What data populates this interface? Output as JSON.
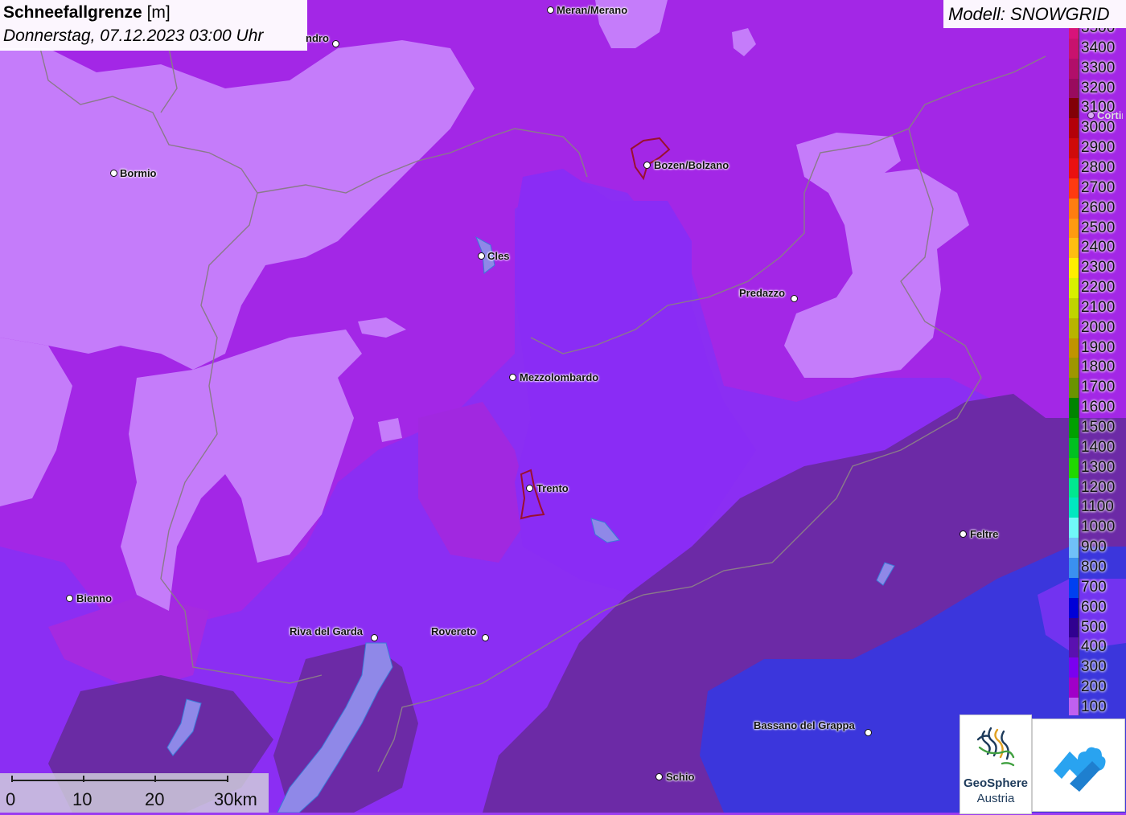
{
  "header": {
    "title_bold": "Schneefallgrenze",
    "title_unit": "[m]",
    "datetime": "Donnerstag, 07.12.2023 03:00 Uhr"
  },
  "model_label": "Modell: SNOWGRID",
  "legend": {
    "items": [
      {
        "label": "3500",
        "color": "#d8137a"
      },
      {
        "label": "3400",
        "color": "#c8126e"
      },
      {
        "label": "3300",
        "color": "#b10e6a"
      },
      {
        "label": "3200",
        "color": "#990a5e"
      },
      {
        "label": "3100",
        "color": "#820006"
      },
      {
        "label": "3000",
        "color": "#b4000a"
      },
      {
        "label": "2900",
        "color": "#d00a0a"
      },
      {
        "label": "2800",
        "color": "#ea1010"
      },
      {
        "label": "2700",
        "color": "#ff3a10"
      },
      {
        "label": "2600",
        "color": "#ff7d10"
      },
      {
        "label": "2500",
        "color": "#ff9a10"
      },
      {
        "label": "2400",
        "color": "#ffbe10"
      },
      {
        "label": "2300",
        "color": "#ffee00"
      },
      {
        "label": "2200",
        "color": "#d8f000"
      },
      {
        "label": "2100",
        "color": "#c0d400"
      },
      {
        "label": "2000",
        "color": "#b8b400"
      },
      {
        "label": "1900",
        "color": "#c09400"
      },
      {
        "label": "1800",
        "color": "#9e9600"
      },
      {
        "label": "1700",
        "color": "#6a9400"
      },
      {
        "label": "1600",
        "color": "#008400"
      },
      {
        "label": "1500",
        "color": "#00a000"
      },
      {
        "label": "1400",
        "color": "#00c020"
      },
      {
        "label": "1300",
        "color": "#20d800"
      },
      {
        "label": "1200",
        "color": "#00e890"
      },
      {
        "label": "1100",
        "color": "#00e8c0"
      },
      {
        "label": "1000",
        "color": "#70f8f8"
      },
      {
        "label": "900",
        "color": "#70c0f8"
      },
      {
        "label": "800",
        "color": "#3a90f0"
      },
      {
        "label": "700",
        "color": "#0040f0"
      },
      {
        "label": "600",
        "color": "#0000d8"
      },
      {
        "label": "500",
        "color": "#300090"
      },
      {
        "label": "400",
        "color": "#5a10b0"
      },
      {
        "label": "300",
        "color": "#7a00f0"
      },
      {
        "label": "200",
        "color": "#a000c8"
      },
      {
        "label": "100",
        "color": "#c060f0"
      }
    ]
  },
  "cities": [
    {
      "name": "Meran/Merano",
      "label_side": "right"
    },
    {
      "name": "ndro",
      "label_side": "left"
    },
    {
      "name": "Bormio",
      "label_side": "right"
    },
    {
      "name": "Bozen/Bolzano",
      "label_side": "right"
    },
    {
      "name": "Cles",
      "label_side": "right"
    },
    {
      "name": "Cortin",
      "label_side": "right"
    },
    {
      "name": "Predazzo",
      "label_side": "left"
    },
    {
      "name": "Mezzolombardo",
      "label_side": "right"
    },
    {
      "name": "Trento",
      "label_side": "right"
    },
    {
      "name": "Feltre",
      "label_side": "right"
    },
    {
      "name": "Bienno",
      "label_side": "right"
    },
    {
      "name": "Riva del Garda",
      "label_side": "left"
    },
    {
      "name": "Rovereto",
      "label_side": "left"
    },
    {
      "name": "Bassano del Grappa",
      "label_side": "left"
    },
    {
      "name": "Schio",
      "label_side": "right"
    }
  ],
  "scale": {
    "labels": [
      "0",
      "10",
      "20",
      "30km"
    ]
  },
  "logos": {
    "geosphere_line1": "GeoSphere",
    "geosphere_line2": "Austria"
  },
  "colors": {
    "light_lilac": "#c77cff",
    "magenta_purple": "#a226e8",
    "violet": "#8a2cf5",
    "dark_purple": "#6a2aa8",
    "blue": "#3a35dd",
    "border_line": "#8a7a8a",
    "city_boundary": "#9a1030"
  }
}
